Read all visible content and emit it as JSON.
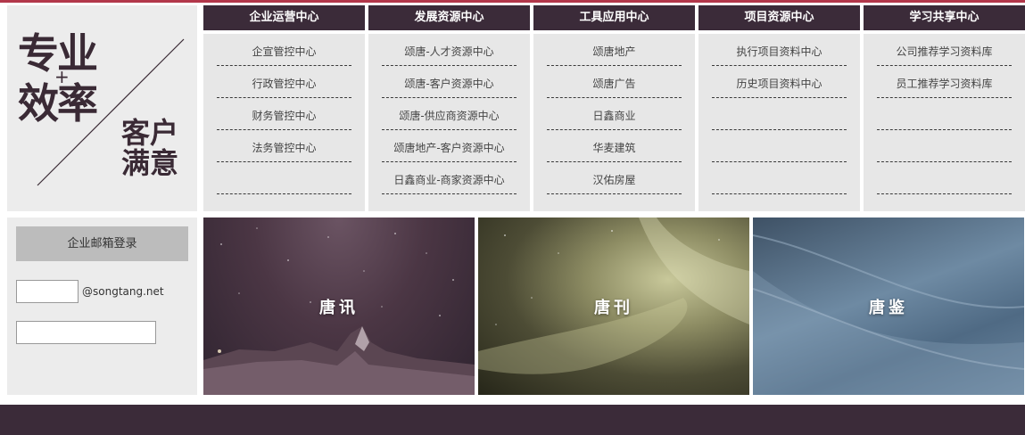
{
  "logo": {
    "line1": "专业",
    "line2": "效率",
    "plus": "+",
    "line3": "客户",
    "line4": "满意"
  },
  "columns": [
    {
      "title": "企业运营中心",
      "items": [
        "企宣管控中心",
        "行政管控中心",
        "财务管控中心",
        "法务管控中心",
        ""
      ]
    },
    {
      "title": "发展资源中心",
      "items": [
        "颂唐-人才资源中心",
        "颂唐-客户资源中心",
        "颂唐-供应商资源中心",
        "颂唐地产-客户资源中心",
        "日鑫商业-商家资源中心"
      ]
    },
    {
      "title": "工具应用中心",
      "items": [
        "颂唐地产",
        "颂唐广告",
        "日鑫商业",
        "华麦建筑",
        "汉佑房屋"
      ]
    },
    {
      "title": "项目资源中心",
      "items": [
        "执行项目资料中心",
        "历史项目资料中心",
        "",
        "",
        ""
      ]
    },
    {
      "title": "学习共享中心",
      "items": [
        "公司推荐学习资料库",
        "员工推荐学习资料库",
        "",
        "",
        ""
      ]
    }
  ],
  "login": {
    "button_label": "企业邮箱登录",
    "domain_suffix": "@songtang.net"
  },
  "tiles": [
    {
      "label": "唐讯"
    },
    {
      "label": "唐刊"
    },
    {
      "label": "唐鉴"
    }
  ],
  "colors": {
    "header_bg": "#3b2b39",
    "panel_bg": "#e7e7e7",
    "accent_line": "#b2374a"
  }
}
